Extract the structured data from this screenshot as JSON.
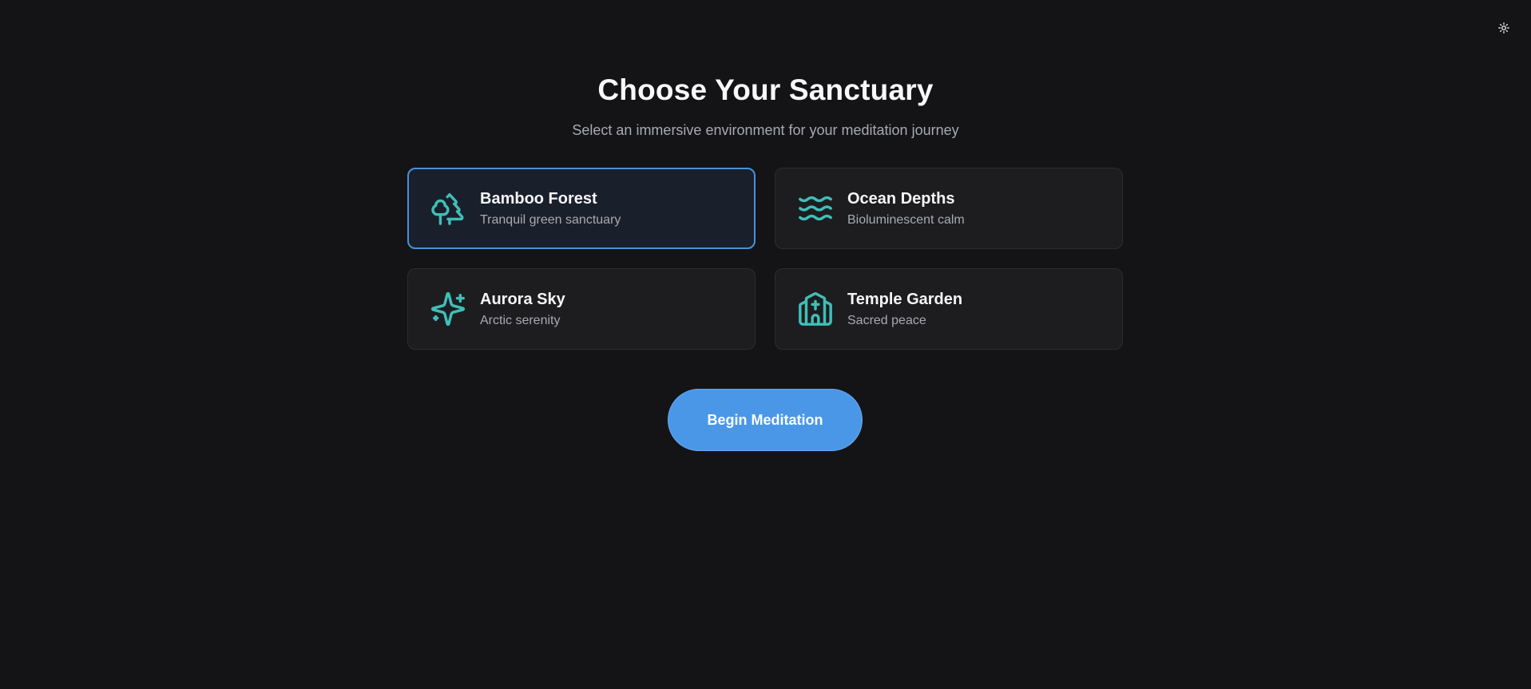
{
  "header": {
    "theme_toggle_icon": "sun-icon"
  },
  "main": {
    "title": "Choose Your Sanctuary",
    "subtitle": "Select an immersive environment for your meditation journey"
  },
  "environments": [
    {
      "icon": "trees-icon",
      "title": "Bamboo Forest",
      "subtitle": "Tranquil green sanctuary",
      "selected": true
    },
    {
      "icon": "waves-icon",
      "title": "Ocean Depths",
      "subtitle": "Bioluminescent calm",
      "selected": false
    },
    {
      "icon": "sparkles-icon",
      "title": "Aurora Sky",
      "subtitle": "Arctic serenity",
      "selected": false
    },
    {
      "icon": "church-icon",
      "title": "Temple Garden",
      "subtitle": "Sacred peace",
      "selected": false
    }
  ],
  "actions": {
    "begin_label": "Begin Meditation"
  },
  "colors": {
    "background": "#141416",
    "card": "#1d1d20",
    "accent": "#4a97e8",
    "selected_border": "#4a90d9",
    "icon": "#3fbfb8"
  }
}
